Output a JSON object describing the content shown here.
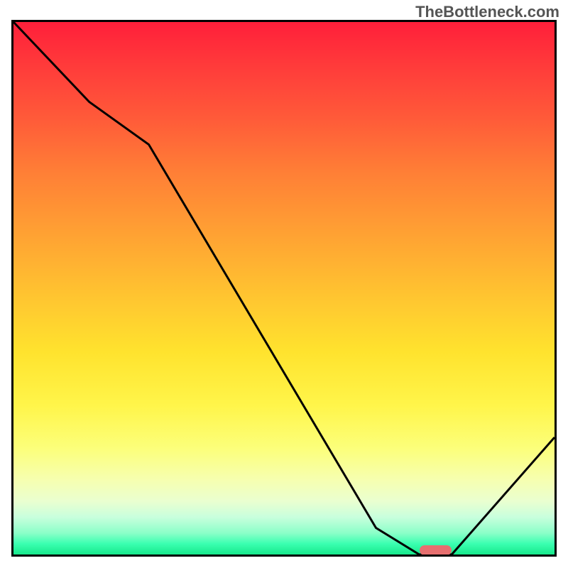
{
  "watermark": "TheBottleneck.com",
  "chart_data": {
    "type": "line",
    "title": "",
    "xlabel": "",
    "ylabel": "",
    "xlim": [
      0,
      100
    ],
    "ylim": [
      0,
      100
    ],
    "grid": false,
    "series": [
      {
        "name": "curve",
        "x": [
          0,
          14,
          25,
          67,
          75,
          81,
          100
        ],
        "y": [
          100,
          85,
          77,
          5,
          0,
          0,
          22
        ],
        "color": "#000000"
      }
    ],
    "marker": {
      "x_start": 75,
      "x_end": 81,
      "y": 0,
      "color": "#e76f6f"
    },
    "gradient_stops": [
      {
        "pos": 0,
        "color": "#ff1f3a"
      },
      {
        "pos": 18,
        "color": "#ff5a39"
      },
      {
        "pos": 40,
        "color": "#ffa233"
      },
      {
        "pos": 62,
        "color": "#ffe32e"
      },
      {
        "pos": 80,
        "color": "#fcff7a"
      },
      {
        "pos": 93,
        "color": "#c8ffdd"
      },
      {
        "pos": 100,
        "color": "#17e88b"
      }
    ]
  }
}
